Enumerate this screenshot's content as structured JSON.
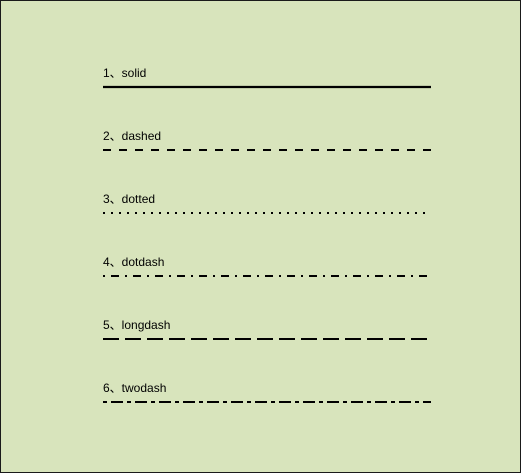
{
  "items": [
    {
      "label": "1、solid",
      "style": "solid"
    },
    {
      "label": "2、dashed",
      "style": "dashed"
    },
    {
      "label": "3、dotted",
      "style": "dotted"
    },
    {
      "label": "4、dotdash",
      "style": "dotdash"
    },
    {
      "label": "5、longdash",
      "style": "longdash"
    },
    {
      "label": "6、twodash",
      "style": "twodash"
    }
  ],
  "colors": {
    "background": "#d8e4bc",
    "line": "#000000",
    "border": "#1a1a1a"
  }
}
